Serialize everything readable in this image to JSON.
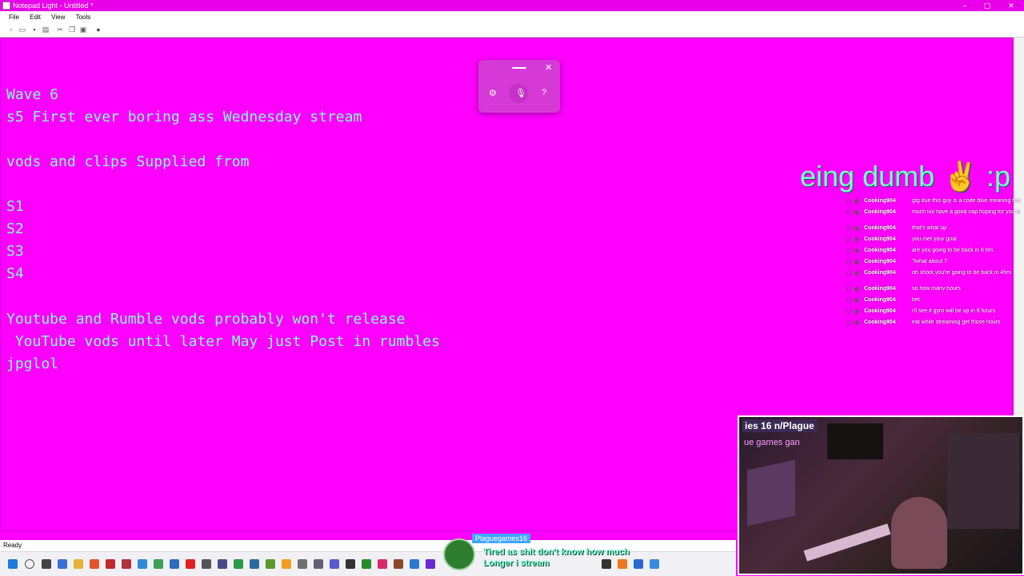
{
  "window": {
    "title": "Notepad Light - Untitled *",
    "controls": {
      "minimize": "–",
      "maximize": "▢",
      "close": "✕"
    }
  },
  "menubar": {
    "items": [
      "File",
      "Edit",
      "View",
      "Tools"
    ]
  },
  "toolbar": {
    "icons": [
      "new-icon",
      "open-icon",
      "save-icon",
      "print-icon",
      "cut-icon",
      "copy-icon",
      "paste-icon",
      "help-icon"
    ]
  },
  "editor": {
    "lines": [
      "Wave 6",
      "s5 First ever boring ass Wednesday stream",
      "",
      "vods and clips Supplied from",
      "",
      "S1",
      "S2",
      "S3",
      "S4",
      "",
      "Youtube and Rumble vods probably won't release",
      " YouTube vods until later May just Post in rumbles",
      "jpglol"
    ]
  },
  "voice_panel": {
    "icons": [
      "settings-icon",
      "microphone-icon",
      "help-icon"
    ]
  },
  "overlay": {
    "big_text": "eing dumb ✌ :p"
  },
  "chat": {
    "messages": [
      {
        "user": "Cooking904",
        "text": "gtg due this guy is a code blue meaning he's dying"
      },
      {
        "user": "Cooking904",
        "text": "much luv have a good nap hoping for you to be back in 6 hrs"
      },
      {
        "user": "Cooking904",
        "text": "that's what up"
      },
      {
        "user": "Cooking904",
        "text": "you met your goal"
      },
      {
        "user": "Cooking904",
        "text": "are you going to be back in 6 hrs"
      },
      {
        "user": "Cooking904",
        "text": "?what about 7"
      },
      {
        "user": "Cooking904",
        "text": "oh shoot you're going to be back in 4hrs"
      },
      {
        "user": "Cooking904",
        "text": "so how many hours"
      },
      {
        "user": "Cooking904",
        "text": "bet"
      },
      {
        "user": "Cooking904",
        "text": "i'll see if gyro will be up in 6 hours"
      },
      {
        "user": "Cooking904",
        "text": "eat while streaming get those hours"
      }
    ]
  },
  "webcam": {
    "tag": "ies 16 n/Plague",
    "subtag": "ue games gan"
  },
  "statusbar": {
    "text": "Ready"
  },
  "chat_popup": {
    "name": "Plaguegames16",
    "text": "Tired as shit don't know how much Longer i stream"
  }
}
